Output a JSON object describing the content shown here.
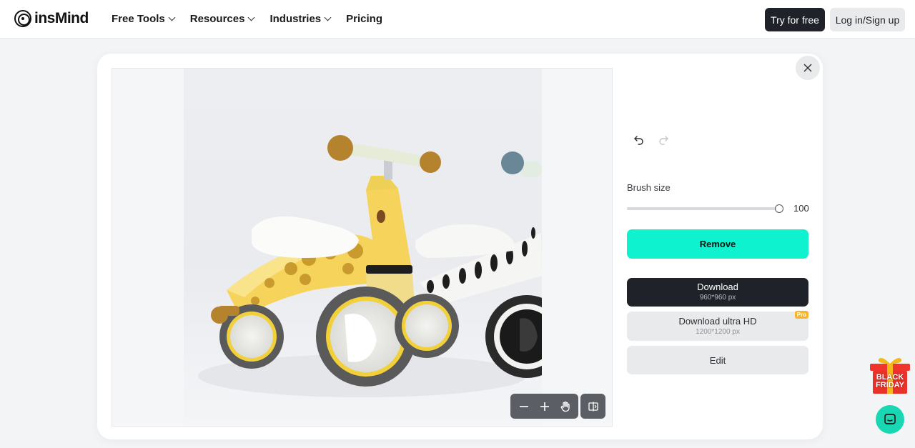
{
  "header": {
    "logo_text": "insMind",
    "nav": [
      {
        "label": "Free Tools",
        "has_dropdown": true
      },
      {
        "label": "Resources",
        "has_dropdown": true
      },
      {
        "label": "Industries",
        "has_dropdown": true
      },
      {
        "label": "Pricing",
        "has_dropdown": false
      }
    ],
    "try_label": "Try for free",
    "login_label": "Log in/Sign up"
  },
  "editor": {
    "brush_label": "Brush size",
    "brush_value": "100",
    "brush_fraction": 1.0,
    "remove_label": "Remove",
    "download": {
      "label": "Download",
      "size": "960*960 px"
    },
    "download_uhd": {
      "label": "Download ultra HD",
      "size": "1200*1200 px",
      "badge": "Pro"
    },
    "edit_label": "Edit"
  },
  "promo": {
    "line1": "BLACK",
    "line2": "FRIDAY"
  },
  "colors": {
    "accent": "#0ff2d0",
    "dark_button": "#1f2329",
    "pro_badge": "#f7b528",
    "chat_button": "#19d7b3",
    "promo_red": "#e8322b"
  },
  "icons": [
    "close-icon",
    "undo-icon",
    "redo-icon",
    "zoom-out-icon",
    "zoom-in-icon",
    "hand-pan-icon",
    "compare-icon",
    "chat-icon",
    "gift-icon"
  ]
}
